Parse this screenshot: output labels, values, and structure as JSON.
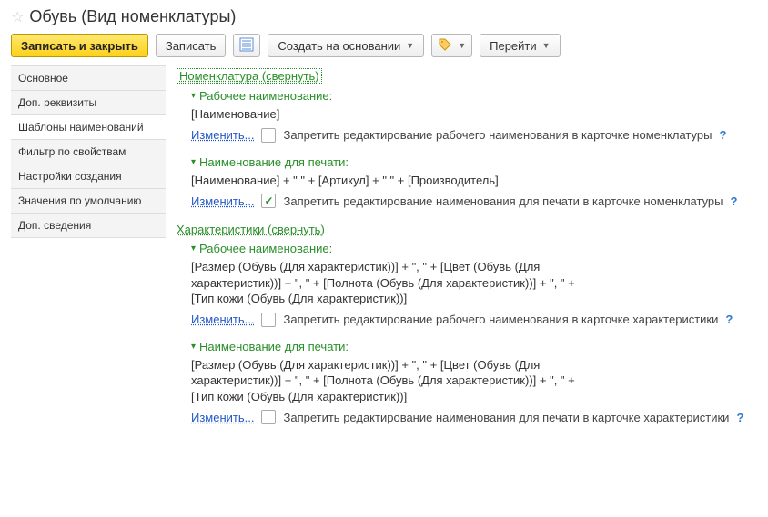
{
  "title": "Обувь (Вид номенклатуры)",
  "toolbar": {
    "write_close": "Записать и закрыть",
    "write": "Записать",
    "create_from": "Создать на основании",
    "go": "Перейти"
  },
  "tabs": [
    "Основное",
    "Доп. реквизиты",
    "Шаблоны наименований",
    "Фильтр по свойствам",
    "Настройки создания",
    "Значения по умолчанию",
    "Доп. сведения"
  ],
  "active_tab": 2,
  "sections": {
    "nomen": {
      "head": "Номенклатура (свернуть)",
      "work": {
        "head": "Рабочее наименование:",
        "formula": "[Наименование]",
        "edit": "Изменить...",
        "opt": "Запретить редактирование рабочего наименования в карточке номенклатуры",
        "checked": false
      },
      "print": {
        "head": "Наименование для печати:",
        "formula": "[Наименование] + \" \" + [Артикул] + \" \" + [Производитель]",
        "edit": "Изменить...",
        "opt": "Запретить редактирование наименования для печати в карточке номенклатуры",
        "checked": true
      }
    },
    "char": {
      "head": "Характеристики (свернуть)",
      "work": {
        "head": "Рабочее наименование:",
        "formula": "[Размер (Обувь (Для характеристик))] + \", \" + [Цвет (Обувь (Для характеристик))] + \", \" + [Полнота (Обувь (Для характеристик))] + \", \" + [Тип кожи (Обувь (Для характеристик))]",
        "edit": "Изменить...",
        "opt": "Запретить редактирование рабочего наименования в карточке характеристики",
        "checked": false
      },
      "print": {
        "head": "Наименование для печати:",
        "formula": "[Размер (Обувь (Для характеристик))] + \", \" + [Цвет (Обувь (Для характеристик))] + \", \" + [Полнота (Обувь (Для характеристик))] + \", \" + [Тип кожи (Обувь (Для характеристик))]",
        "edit": "Изменить...",
        "opt": "Запретить редактирование наименования для печати в карточке характеристики",
        "checked": false
      }
    }
  },
  "help": "?"
}
